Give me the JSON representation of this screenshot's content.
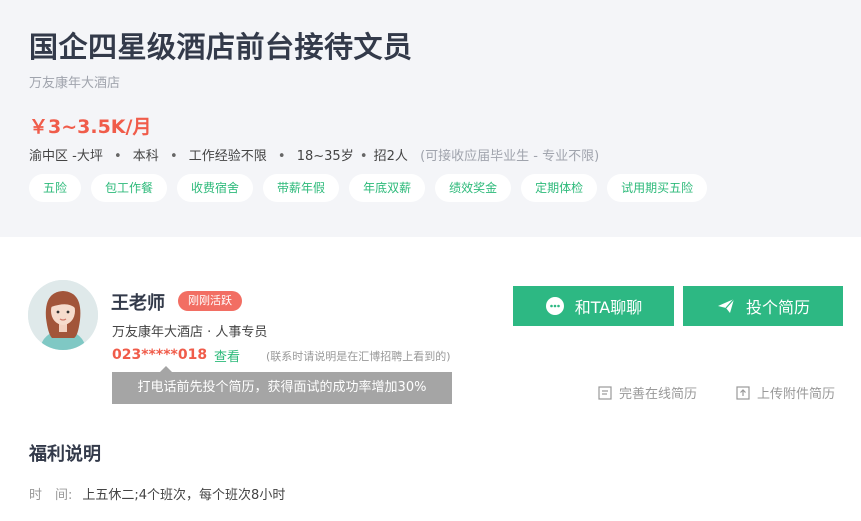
{
  "job": {
    "title": "国企四星级酒店前台接待文员",
    "company": "万友康年大酒店",
    "salary": "￥3~3.5K/月",
    "meta": {
      "location": "渝中区 -大坪",
      "education": "本科",
      "experience": "工作经验不限",
      "age": "18~35岁",
      "headcount": "招2人",
      "note": "(可接收应届毕业生 - 专业不限)"
    },
    "tags": [
      "五险",
      "包工作餐",
      "收费宿舍",
      "带薪年假",
      "年底双薪",
      "绩效奖金",
      "定期体检",
      "试用期买五险"
    ]
  },
  "contact": {
    "name": "王老师",
    "active_badge": "刚刚活跃",
    "role": "万友康年大酒店 · 人事专员",
    "phone": "023*****018",
    "view_label": "查看",
    "phone_note": "(联系时请说明是在汇博招聘上看到的)",
    "tooltip": "打电话前先投个简历，获得面试的成功率增加30%",
    "chat_button": "和TA聊聊",
    "apply_button": "投个简历",
    "improve_resume": "完善在线简历",
    "upload_resume": "上传附件简历"
  },
  "welfare": {
    "title": "福利说明",
    "time_label": "时　间:",
    "time_value": "上五休二;4个班次，每个班次8小时"
  },
  "colors": {
    "accent_green": "#2db883",
    "salary_red": "#f05c4a",
    "badge_red": "#f26e63",
    "header_bg": "#f4f5f8"
  }
}
